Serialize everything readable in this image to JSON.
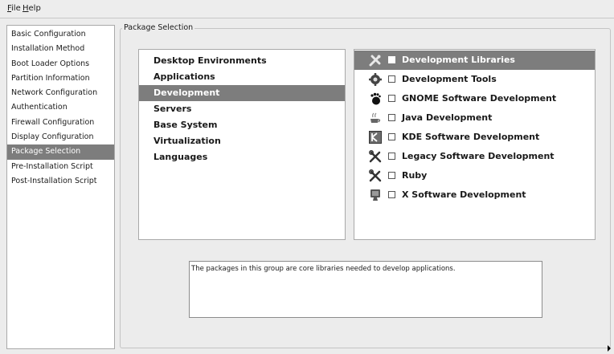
{
  "menubar": {
    "file": {
      "mnemonic": "F",
      "rest": "ile"
    },
    "help": {
      "mnemonic": "H",
      "rest": "elp"
    }
  },
  "sidebar": {
    "items": [
      {
        "label": "Basic Configuration"
      },
      {
        "label": "Installation Method"
      },
      {
        "label": "Boot Loader Options"
      },
      {
        "label": "Partition Information"
      },
      {
        "label": "Network Configuration"
      },
      {
        "label": "Authentication"
      },
      {
        "label": "Firewall Configuration"
      },
      {
        "label": "Display Configuration"
      },
      {
        "label": "Package Selection",
        "selected": true
      },
      {
        "label": "Pre-Installation Script"
      },
      {
        "label": "Post-Installation Script"
      }
    ]
  },
  "main": {
    "title": "Package Selection",
    "groups": [
      {
        "label": "Desktop Environments"
      },
      {
        "label": "Applications"
      },
      {
        "label": "Development",
        "selected": true
      },
      {
        "label": "Servers"
      },
      {
        "label": "Base System"
      },
      {
        "label": "Virtualization"
      },
      {
        "label": "Languages"
      }
    ],
    "packages": [
      {
        "label": "Development Libraries",
        "icon": "wrench-icon",
        "checked": true,
        "selected": true
      },
      {
        "label": "Development Tools",
        "icon": "gear-icon",
        "checked": false
      },
      {
        "label": "GNOME Software Development",
        "icon": "gnome-foot-icon",
        "checked": false
      },
      {
        "label": "Java Development",
        "icon": "java-cup-icon",
        "checked": false
      },
      {
        "label": "KDE Software Development",
        "icon": "kde-icon",
        "checked": false
      },
      {
        "label": "Legacy Software Development",
        "icon": "tools-icon",
        "checked": false
      },
      {
        "label": "Ruby",
        "icon": "tools-icon",
        "checked": false
      },
      {
        "label": "X Software Development",
        "icon": "monitor-icon",
        "checked": false
      }
    ],
    "description": "The packages in this group are core libraries needed to develop applications."
  },
  "colors": {
    "selection": "#7d7d7d",
    "background": "#ececec"
  }
}
